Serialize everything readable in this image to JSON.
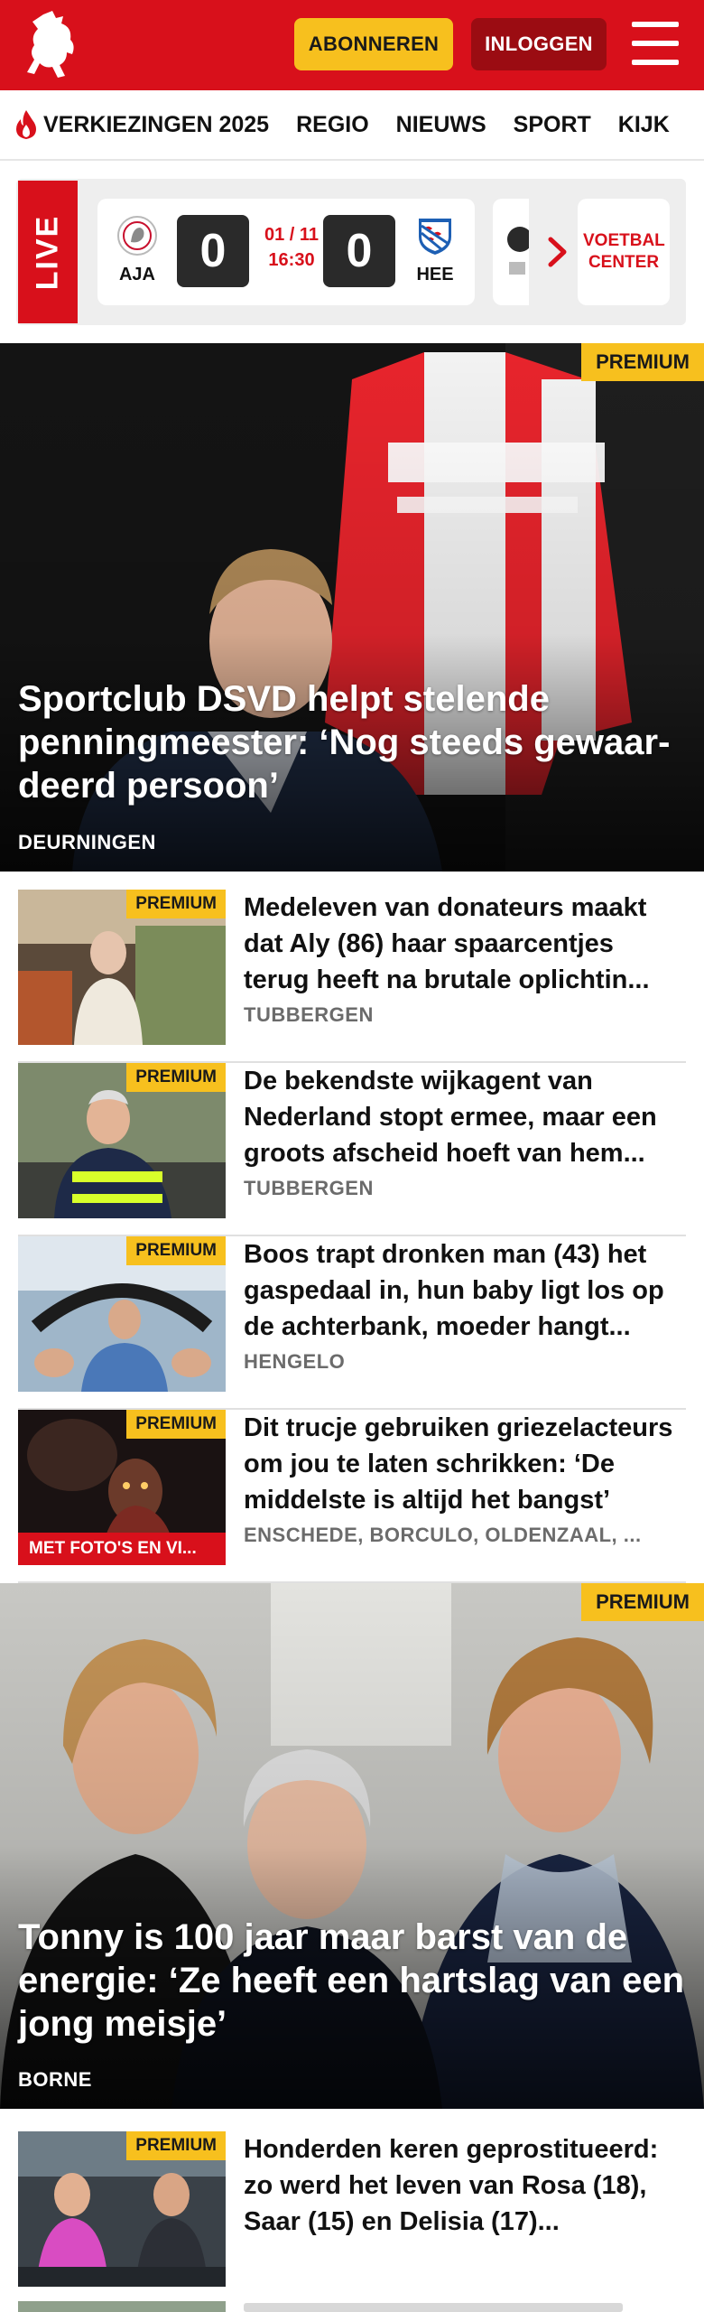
{
  "header": {
    "subscribe_label": "ABONNEREN",
    "login_label": "INLOGGEN",
    "brand_color": "#d8101b",
    "subscribe_color": "#f7c01e"
  },
  "nav": {
    "items": [
      {
        "label": "VERKIEZINGEN 2025",
        "icon": "flame-icon"
      },
      {
        "label": "REGIO"
      },
      {
        "label": "NIEUWS"
      },
      {
        "label": "SPORT"
      },
      {
        "label": "KIJK"
      }
    ]
  },
  "live": {
    "tag": "LIVE",
    "match": {
      "home": "AJA",
      "away": "HEE",
      "home_score": "0",
      "away_score": "0",
      "date": "01 / 11",
      "time": "16:30"
    },
    "football_center": "VOETBAL CENTER"
  },
  "hero1": {
    "premium": "PREMIUM",
    "title": "Sportclub DSVD helpt stelende penningmeester: ‘Nog steeds gewaar­deerd persoon’",
    "location": "DEURNINGEN"
  },
  "articles": [
    {
      "premium": "PREMIUM",
      "title": "Medeleven van donateurs maakt dat Aly (86) haar spaarcentjes terug heeft na brutale oplichtin...",
      "location": "TUBBERGEN"
    },
    {
      "premium": "PREMIUM",
      "title": "De bekendste wijkagent van Nederland stopt ermee, maar een groots afscheid hoeft van hem...",
      "location": "TUBBERGEN"
    },
    {
      "premium": "PREMIUM",
      "title": "Boos trapt dronken man (43) het gaspedaal in, hun baby ligt los op de achterbank, moeder hangt...",
      "location": "HENGELO"
    },
    {
      "premium": "PREMIUM",
      "photo_tag": "MET FOTO'S EN VI...",
      "title": "Dit trucje gebruiken griezelac­teurs om jou te laten schrikken: ‘De middelste is altijd het bangst’",
      "location": "ENSCHEDE, BORCULO, OLDENZAAL, ..."
    }
  ],
  "hero2": {
    "premium": "PREMIUM",
    "title": "Tonny is 100 jaar maar barst van de energie: ‘Ze heeft een hartslag van een jong meisje’",
    "location": "BORNE"
  },
  "articles2": [
    {
      "premium": "PREMIUM",
      "title": "Honderden keren geprostitueerd: zo werd het leven van Rosa (18), Saar (15) en Delisia (17)..."
    }
  ]
}
